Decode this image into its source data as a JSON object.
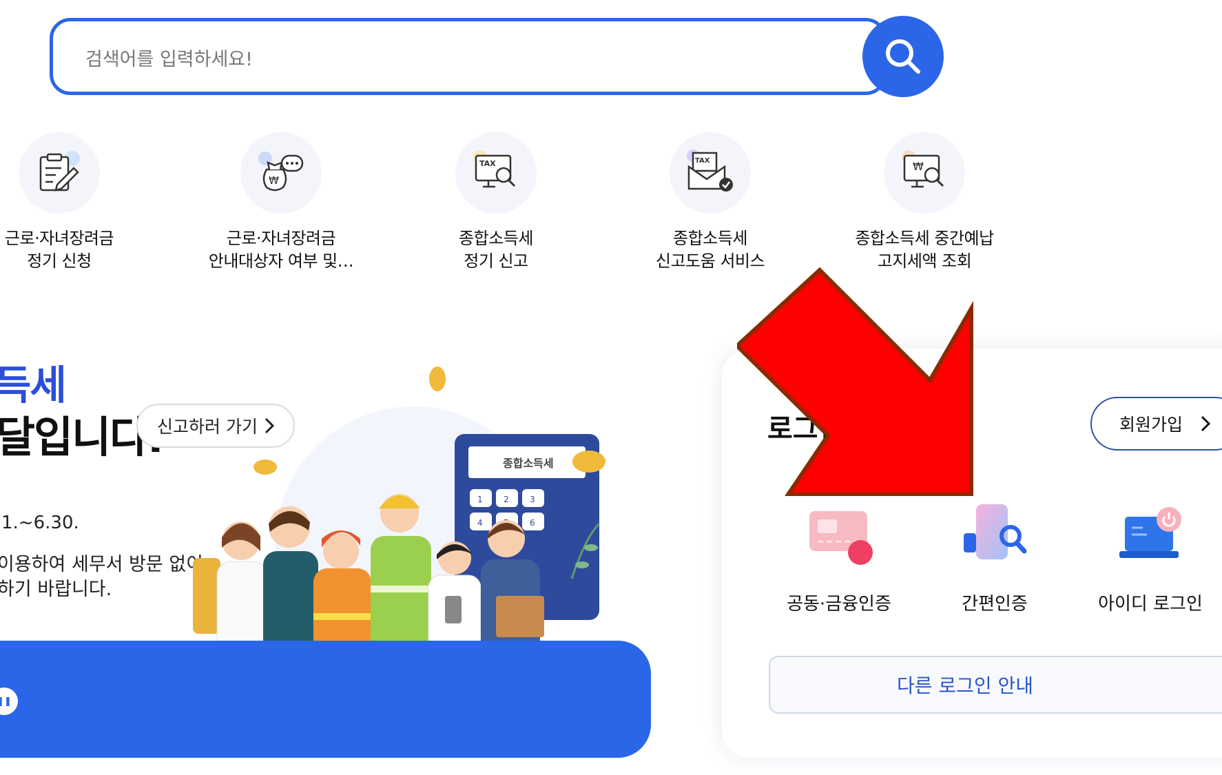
{
  "search": {
    "placeholder": "검색어를 입력하세요!"
  },
  "quick_menu": [
    {
      "line1": "근로·자녀장려금",
      "line2": "정기 신청",
      "icon": "clipboard-pen-icon"
    },
    {
      "line1": "근로·자녀장려금",
      "line2": "안내대상자 여부 및…",
      "icon": "money-bag-chat-icon"
    },
    {
      "line1": "종합소득세",
      "line2": "정기 신고",
      "icon": "tax-monitor-search-icon"
    },
    {
      "line1": "종합소득세",
      "line2": "신고도움 서비스",
      "icon": "tax-envelope-check-icon"
    },
    {
      "line1": "종합소득세 중간예납",
      "line2": "고지세액 조회",
      "icon": "won-monitor-search-icon"
    }
  ],
  "banner": {
    "title_line1": "득세",
    "title_line2": "달입니다.",
    "go_button": "신고하러 가기",
    "period": "1.~6.30.",
    "desc_line1": "이용하여 세무서 방문 없이",
    "desc_line2": "하기 바랍니다.",
    "calculator_label": "종합소득세",
    "calc_keys": [
      "1",
      "2",
      "3",
      "4",
      "5",
      "6"
    ]
  },
  "login": {
    "title": "로그인",
    "join_button": "회원가입",
    "options": [
      {
        "label": "공동·금융인증",
        "icon": "certificate-card-icon"
      },
      {
        "label": "간편인증",
        "icon": "simple-auth-phone-icon"
      },
      {
        "label": "아이디 로그인",
        "icon": "laptop-power-icon"
      }
    ],
    "other_button": "다른 로그인 안내"
  },
  "colors": {
    "primary": "#2b66e8",
    "arrow": "#ff0000",
    "arrow_border": "#8b2a00"
  }
}
